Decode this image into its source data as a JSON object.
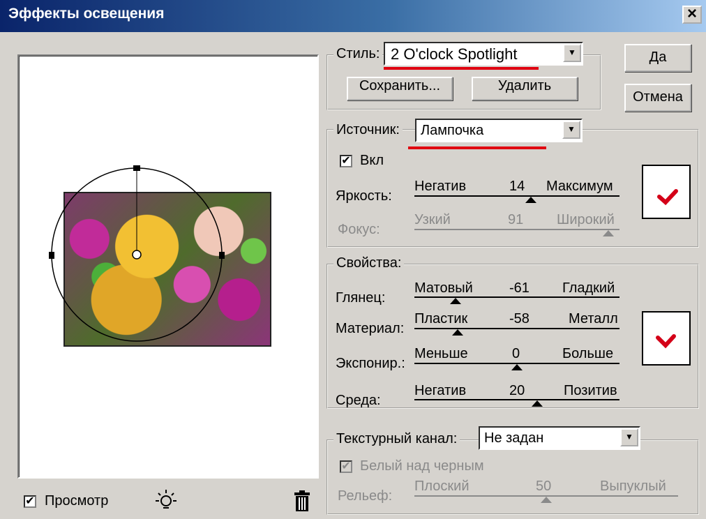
{
  "window": {
    "title": "Эффекты освещения",
    "close_glyph": "×"
  },
  "style_section": {
    "label": "Стиль:",
    "value": "2 O'clock Spotlight",
    "save_label": "Сохранить...",
    "delete_label": "Удалить"
  },
  "buttons": {
    "ok": "Да",
    "cancel": "Отмена"
  },
  "source_section": {
    "label": "Источник:",
    "value": "Лампочка",
    "on_label": "Вкл",
    "on_checked": true,
    "intensity": {
      "label": "Яркость:",
      "min": "Негатив",
      "value": "14",
      "max": "Максимум",
      "level_percent": 57
    },
    "focus": {
      "label": "Фокус:",
      "min": "Узкий",
      "value": "91",
      "max": "Широкий",
      "level_percent": 95,
      "disabled": true
    }
  },
  "properties_section": {
    "label": "Свойства:",
    "gloss": {
      "label": "Глянец:",
      "min": "Матовый",
      "value": "-61",
      "max": "Гладкий",
      "level_percent": 20
    },
    "material": {
      "label": "Материал:",
      "min": "Пластик",
      "value": "-58",
      "max": "Металл",
      "level_percent": 21
    },
    "exposure": {
      "label": "Экспонир.:",
      "min": "Меньше",
      "value": "0",
      "max": "Больше",
      "level_percent": 50
    },
    "ambience": {
      "label": "Среда:",
      "min": "Негатив",
      "value": "20",
      "max": "Позитив",
      "level_percent": 60
    }
  },
  "texture_section": {
    "label": "Текстурный канал:",
    "value": "Не задан",
    "white_high_label": "Белый над черным",
    "white_high_checked": true,
    "height": {
      "label": "Рельеф:",
      "min": "Плоский",
      "value": "50",
      "max": "Выпуклый",
      "level_percent": 50
    }
  },
  "preview": {
    "label": "Просмотр",
    "checked": true
  },
  "colors": {
    "swatch_mark": "#d40018",
    "annotation": "#e00010"
  },
  "icons": {
    "light": "lightbulb-icon",
    "trash": "trash-icon",
    "check": "checkmark-icon"
  }
}
